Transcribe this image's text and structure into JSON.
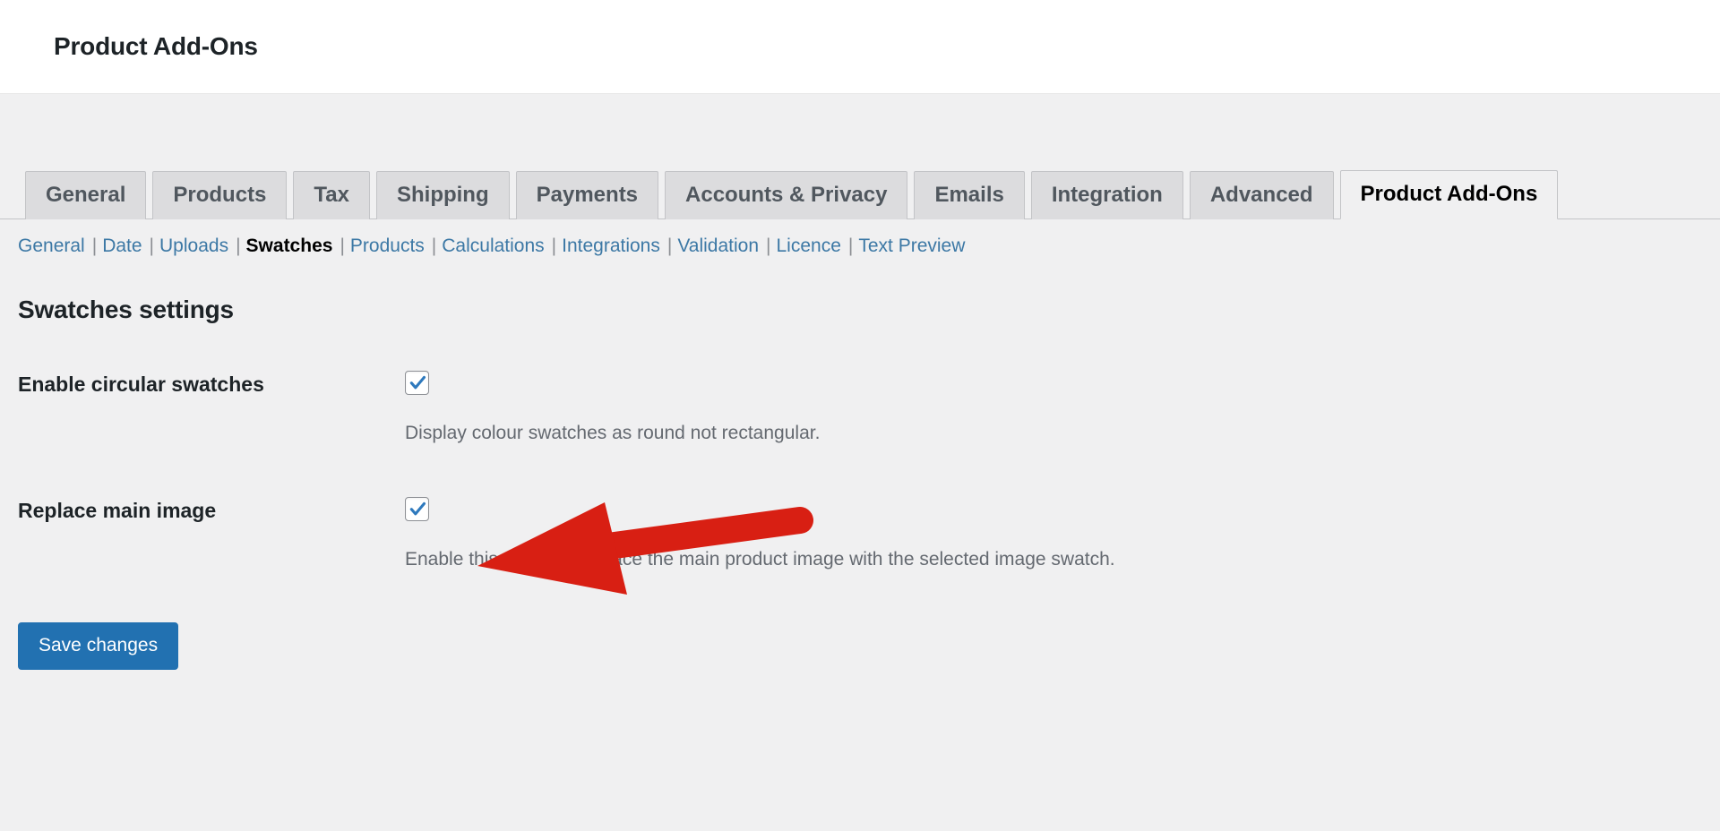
{
  "header": {
    "title": "Product Add-Ons"
  },
  "nav_tabs": [
    {
      "label": "General",
      "active": false
    },
    {
      "label": "Products",
      "active": false
    },
    {
      "label": "Tax",
      "active": false
    },
    {
      "label": "Shipping",
      "active": false
    },
    {
      "label": "Payments",
      "active": false
    },
    {
      "label": "Accounts & Privacy",
      "active": false
    },
    {
      "label": "Emails",
      "active": false
    },
    {
      "label": "Integration",
      "active": false
    },
    {
      "label": "Advanced",
      "active": false
    },
    {
      "label": "Product Add-Ons",
      "active": true
    }
  ],
  "sub_nav": {
    "separator": "|",
    "items": [
      {
        "label": "General",
        "current": false
      },
      {
        "label": "Date",
        "current": false
      },
      {
        "label": "Uploads",
        "current": false
      },
      {
        "label": "Swatches",
        "current": true
      },
      {
        "label": "Products",
        "current": false
      },
      {
        "label": "Calculations",
        "current": false
      },
      {
        "label": "Integrations",
        "current": false
      },
      {
        "label": "Validation",
        "current": false
      },
      {
        "label": "Licence",
        "current": false
      },
      {
        "label": "Text Preview",
        "current": false
      }
    ]
  },
  "section": {
    "title": "Swatches settings"
  },
  "settings": [
    {
      "label": "Enable circular swatches",
      "checked": true,
      "description": "Display colour swatches as round not rectangular."
    },
    {
      "label": "Replace main image",
      "checked": true,
      "description": "Enable this option to replace the main product image with the selected image swatch."
    }
  ],
  "submit": {
    "save_label": "Save changes"
  },
  "colors": {
    "accent_blue": "#2271b1",
    "link_blue": "#3c78a5",
    "annotation_red": "#d81f13",
    "page_background": "#f0f0f1",
    "checkbox_check": "#2e79bd"
  },
  "annotation": {
    "arrow_direction": "left",
    "points_at": "Replace main image"
  }
}
